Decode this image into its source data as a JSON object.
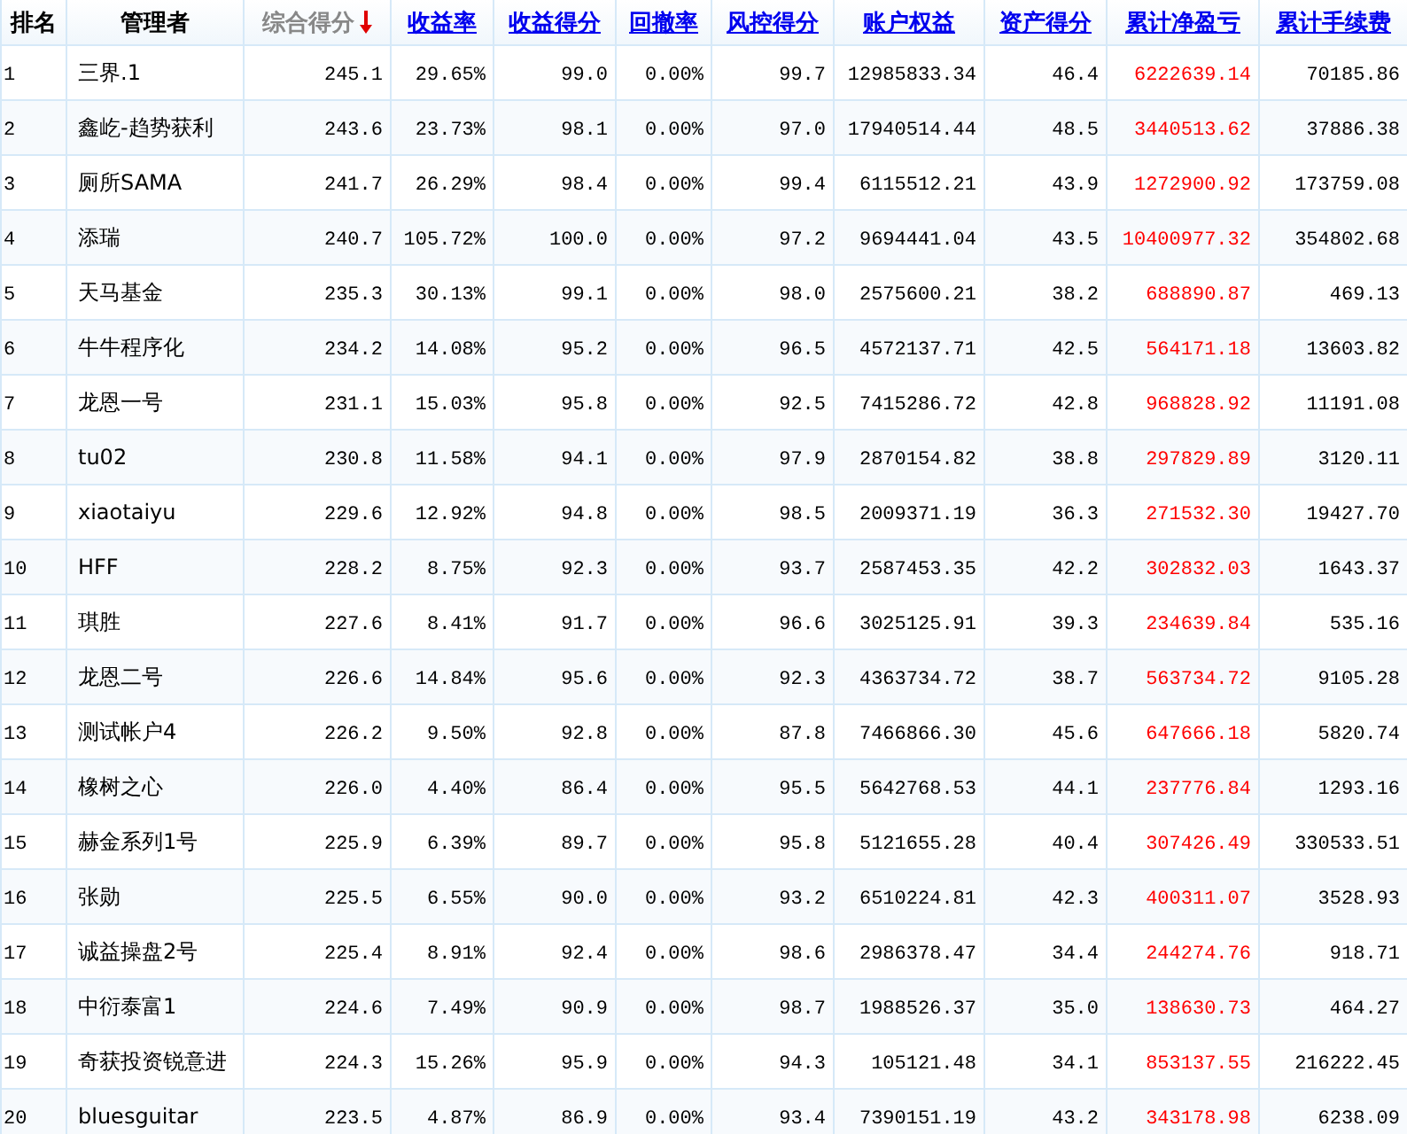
{
  "table": {
    "columns": [
      {
        "label": "排名",
        "kind": "plain",
        "color": "#000000"
      },
      {
        "label": "管理者",
        "kind": "plain",
        "color": "#000000"
      },
      {
        "label": "综合得分",
        "kind": "sorted",
        "color": "#000000"
      },
      {
        "label": "收益率",
        "kind": "link",
        "color": "#000000"
      },
      {
        "label": "收益得分",
        "kind": "link",
        "color": "#000000"
      },
      {
        "label": "回撤率",
        "kind": "link",
        "color": "#000000"
      },
      {
        "label": "风控得分",
        "kind": "link",
        "color": "#000000"
      },
      {
        "label": "账户权益",
        "kind": "link",
        "color": "#000000"
      },
      {
        "label": "资产得分",
        "kind": "link",
        "color": "#000000"
      },
      {
        "label": "累计净盈亏",
        "kind": "link",
        "color": "#ff0000"
      },
      {
        "label": "累计手续费",
        "kind": "link",
        "color": "#000000"
      }
    ],
    "rows": [
      [
        "1",
        "三界.1",
        "245.1",
        "29.65%",
        "99.0",
        "0.00%",
        "99.7",
        "12985833.34",
        "46.4",
        "6222639.14",
        "70185.86"
      ],
      [
        "2",
        "鑫屹-趋势获利",
        "243.6",
        "23.73%",
        "98.1",
        "0.00%",
        "97.0",
        "17940514.44",
        "48.5",
        "3440513.62",
        "37886.38"
      ],
      [
        "3",
        "厕所SAMA",
        "241.7",
        "26.29%",
        "98.4",
        "0.00%",
        "99.4",
        "6115512.21",
        "43.9",
        "1272900.92",
        "173759.08"
      ],
      [
        "4",
        "添瑞",
        "240.7",
        "105.72%",
        "100.0",
        "0.00%",
        "97.2",
        "9694441.04",
        "43.5",
        "10400977.32",
        "354802.68"
      ],
      [
        "5",
        "天马基金",
        "235.3",
        "30.13%",
        "99.1",
        "0.00%",
        "98.0",
        "2575600.21",
        "38.2",
        "688890.87",
        "469.13"
      ],
      [
        "6",
        "牛牛程序化",
        "234.2",
        "14.08%",
        "95.2",
        "0.00%",
        "96.5",
        "4572137.71",
        "42.5",
        "564171.18",
        "13603.82"
      ],
      [
        "7",
        "龙恩一号",
        "231.1",
        "15.03%",
        "95.8",
        "0.00%",
        "92.5",
        "7415286.72",
        "42.8",
        "968828.92",
        "11191.08"
      ],
      [
        "8",
        "tu02",
        "230.8",
        "11.58%",
        "94.1",
        "0.00%",
        "97.9",
        "2870154.82",
        "38.8",
        "297829.89",
        "3120.11"
      ],
      [
        "9",
        "xiaotaiyu",
        "229.6",
        "12.92%",
        "94.8",
        "0.00%",
        "98.5",
        "2009371.19",
        "36.3",
        "271532.30",
        "19427.70"
      ],
      [
        "10",
        "HFF",
        "228.2",
        "8.75%",
        "92.3",
        "0.00%",
        "93.7",
        "2587453.35",
        "42.2",
        "302832.03",
        "1643.37"
      ],
      [
        "11",
        "琪胜",
        "227.6",
        "8.41%",
        "91.7",
        "0.00%",
        "96.6",
        "3025125.91",
        "39.3",
        "234639.84",
        "535.16"
      ],
      [
        "12",
        "龙恩二号",
        "226.6",
        "14.84%",
        "95.6",
        "0.00%",
        "92.3",
        "4363734.72",
        "38.7",
        "563734.72",
        "9105.28"
      ],
      [
        "13",
        "测试帐户4",
        "226.2",
        "9.50%",
        "92.8",
        "0.00%",
        "87.8",
        "7466866.30",
        "45.6",
        "647666.18",
        "5820.74"
      ],
      [
        "14",
        "橡树之心",
        "226.0",
        "4.40%",
        "86.4",
        "0.00%",
        "95.5",
        "5642768.53",
        "44.1",
        "237776.84",
        "1293.16"
      ],
      [
        "15",
        "赫金系列1号",
        "225.9",
        "6.39%",
        "89.7",
        "0.00%",
        "95.8",
        "5121655.28",
        "40.4",
        "307426.49",
        "330533.51"
      ],
      [
        "16",
        "张勋",
        "225.5",
        "6.55%",
        "90.0",
        "0.00%",
        "93.2",
        "6510224.81",
        "42.3",
        "400311.07",
        "3528.93"
      ],
      [
        "17",
        "诚益操盘2号",
        "225.4",
        "8.91%",
        "92.4",
        "0.00%",
        "98.6",
        "2986378.47",
        "34.4",
        "244274.76",
        "918.71"
      ],
      [
        "18",
        "中衍泰富1",
        "224.6",
        "7.49%",
        "90.9",
        "0.00%",
        "98.7",
        "1988526.37",
        "35.0",
        "138630.73",
        "464.27"
      ],
      [
        "19",
        "奇获投资锐意进",
        "224.3",
        "15.26%",
        "95.9",
        "0.00%",
        "94.3",
        "105121.48",
        "34.1",
        "853137.55",
        "216222.45"
      ],
      [
        "20",
        "bluesguitar",
        "223.5",
        "4.87%",
        "86.9",
        "0.00%",
        "93.4",
        "7390151.19",
        "43.2",
        "343178.98",
        "6238.09"
      ]
    ]
  }
}
